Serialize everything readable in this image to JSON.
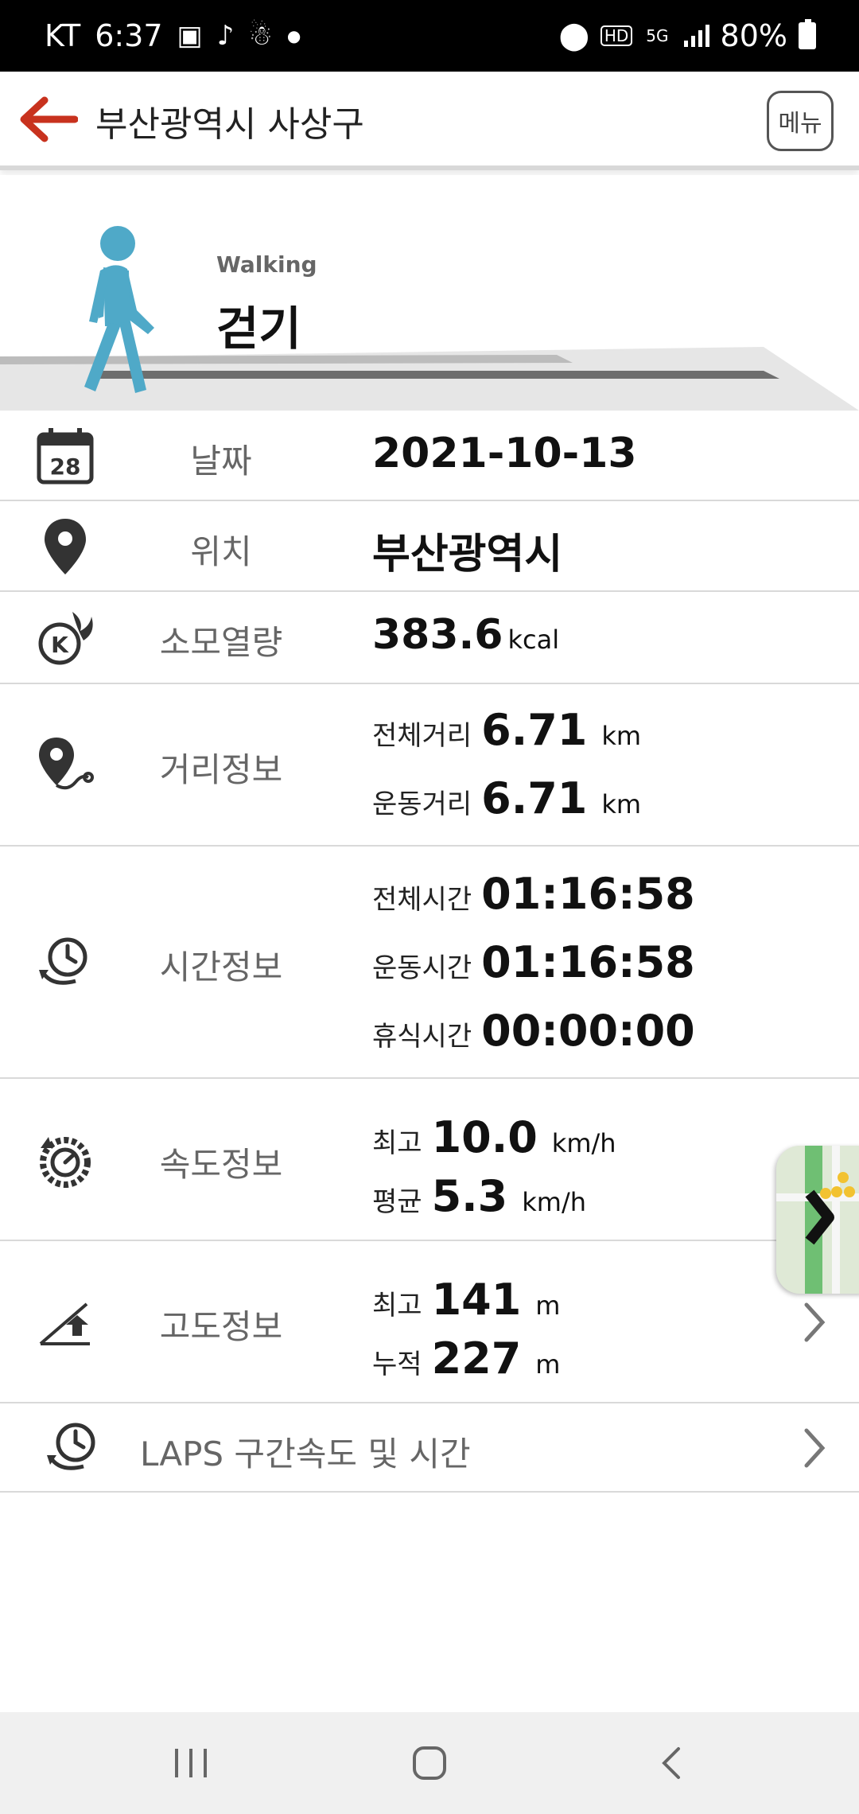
{
  "status_bar": {
    "carrier": "KT",
    "time": "6:37",
    "battery": "80%",
    "network": "5G",
    "hd": "HD"
  },
  "header": {
    "title": "부산광역시 사상구",
    "menu_label": "메뉴"
  },
  "hero": {
    "activity_en": "Walking",
    "activity_ko": "걷기"
  },
  "rows": {
    "date": {
      "label": "날짜",
      "value": "2021-10-13",
      "icon_day": "28"
    },
    "location": {
      "label": "위치",
      "value": "부산광역시"
    },
    "calories": {
      "label": "소모열량",
      "value": "383.6",
      "unit": "kcal"
    },
    "distance": {
      "label": "거리정보",
      "total_label": "전체거리",
      "total_value": "6.71",
      "total_unit": "km",
      "exercise_label": "운동거리",
      "exercise_value": "6.71",
      "exercise_unit": "km"
    },
    "time": {
      "label": "시간정보",
      "total_label": "전체시간",
      "total_value": "01:16:58",
      "exercise_label": "운동시간",
      "exercise_value": "01:16:58",
      "rest_label": "휴식시간",
      "rest_value": "00:00:00"
    },
    "speed": {
      "label": "속도정보",
      "max_label": "최고",
      "max_value": "10.0",
      "max_unit": "km/h",
      "avg_label": "평균",
      "avg_value": "5.3",
      "avg_unit": "km/h"
    },
    "altitude": {
      "label": "고도정보",
      "max_label": "최고",
      "max_value": "141",
      "max_unit": "m",
      "cum_label": "누적",
      "cum_value": "227",
      "cum_unit": "m"
    },
    "laps": {
      "label": "LAPS 구간속도 및 시간"
    }
  },
  "colors": {
    "accent_red": "#c8321e",
    "walker_blue": "#4fa9c8",
    "label_gray": "#666666"
  },
  "icons": {
    "back": "back-arrow-icon",
    "calendar": "calendar-icon",
    "location": "location-pin-icon",
    "calories": "calorie-flame-icon",
    "distance": "route-pin-icon",
    "time": "clock-cycle-icon",
    "speed": "speedometer-icon",
    "altitude": "slope-icon",
    "laps": "clock-cycle-icon"
  }
}
